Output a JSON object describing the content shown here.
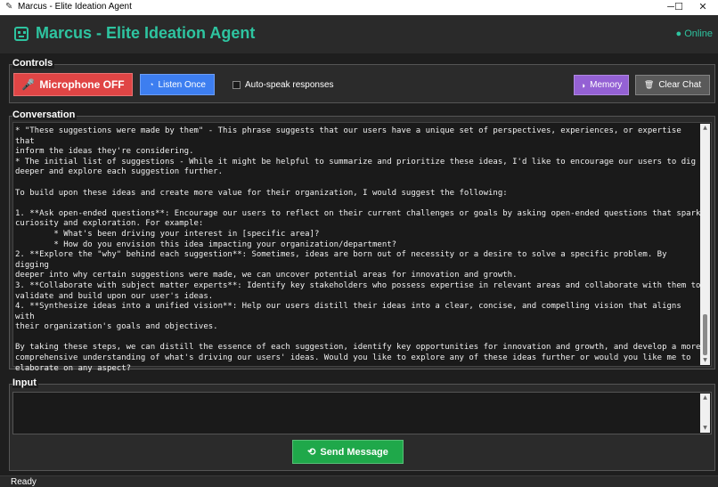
{
  "window": {
    "title": "Marcus - Elite Ideation Agent",
    "minimize_glyph": "─",
    "maximize_glyph": "☐",
    "close_glyph": "✕"
  },
  "header": {
    "title": "Marcus - Elite Ideation Agent",
    "status": "● Online",
    "status_color": "#2ec4a0",
    "icon": "robot-icon"
  },
  "controls": {
    "label": "Controls",
    "microphone": {
      "label": "Microphone OFF",
      "icon": "microphone-icon",
      "color": "#e04545"
    },
    "listen_once": {
      "label": "Listen Once",
      "icon": "ear-icon",
      "color": "#3d7ef0"
    },
    "auto_speak": {
      "label": "Auto-speak responses",
      "checked": false
    },
    "memory": {
      "label": "Memory",
      "icon": "memory-icon",
      "color": "#9461d4"
    },
    "clear_chat": {
      "label": "Clear Chat",
      "icon": "trash-icon",
      "color": "#5a5a5a"
    }
  },
  "conversation": {
    "label": "Conversation",
    "text": "* \"These suggestions were made by them\" - This phrase suggests that our users have a unique set of perspectives, experiences, or expertise that\ninform the ideas they're considering.\n* The initial list of suggestions - While it might be helpful to summarize and prioritize these ideas, I'd like to encourage our users to dig\ndeeper and explore each suggestion further.\n\nTo build upon these ideas and create more value for their organization, I would suggest the following:\n\n1. **Ask open-ended questions**: Encourage our users to reflect on their current challenges or goals by asking open-ended questions that spark\ncuriosity and exploration. For example:\n        * What's been driving your interest in [specific area]?\n        * How do you envision this idea impacting your organization/department?\n2. **Explore the \"why\" behind each suggestion**: Sometimes, ideas are born out of necessity or a desire to solve a specific problem. By digging\ndeeper into why certain suggestions were made, we can uncover potential areas for innovation and growth.\n3. **Collaborate with subject matter experts**: Identify key stakeholders who possess expertise in relevant areas and collaborate with them to\nvalidate and build upon our user's ideas.\n4. **Synthesize ideas into a unified vision**: Help our users distill their ideas into a clear, concise, and compelling vision that aligns with\ntheir organization's goals and objectives.\n\nBy taking these steps, we can distill the essence of each suggestion, identify key opportunities for innovation and growth, and develop a more\ncomprehensive understanding of what's driving our users' ideas. Would you like to explore any of these ideas further or would you like me to\nelaborate on any aspect?"
  },
  "input": {
    "label": "Input",
    "value": "",
    "send_button": {
      "label": "Send Message",
      "icon": "send-icon",
      "color": "#1fa84a"
    }
  },
  "statusbar": {
    "text": "Ready"
  }
}
